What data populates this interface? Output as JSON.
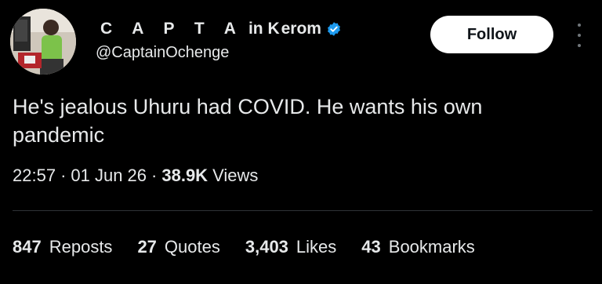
{
  "author": {
    "name_spaced": "C A P T A",
    "name_mid": "in K",
    "name_tail": "erom",
    "handle": "@CaptainOchenge"
  },
  "follow_label": "Follow",
  "tweet_text": "He's jealous Uhuru had COVID. He wants his own pandemic",
  "meta": {
    "time": "22:57",
    "sep1": "·",
    "date": "01 Jun 26",
    "sep2": "·",
    "views_count": "38.9K",
    "views_label": "Views"
  },
  "stats": [
    {
      "count": "847",
      "label": "Reposts"
    },
    {
      "count": "27",
      "label": "Quotes"
    },
    {
      "count": "3,403",
      "label": "Likes"
    },
    {
      "count": "43",
      "label": "Bookmarks"
    }
  ],
  "colors": {
    "verified": "#1d9bf0",
    "background": "#000000",
    "text": "#e7e9ea",
    "divider": "#2f3336"
  }
}
